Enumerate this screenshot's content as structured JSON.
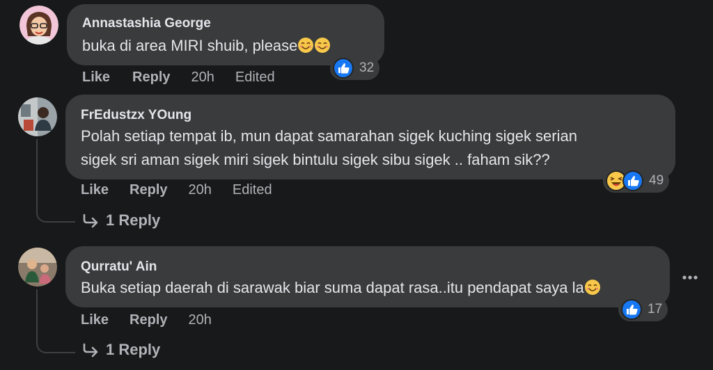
{
  "comments": [
    {
      "author": "Annastashia George",
      "text": "buka di area MIRI shuib, please",
      "reaction_count": "32",
      "actions": {
        "like": "Like",
        "reply": "Reply",
        "time": "20h",
        "edited": "Edited"
      }
    },
    {
      "author": "FrEdustzx YOung",
      "text_line1": "Polah setiap tempat ib, mun dapat samarahan sigek kuching sigek serian",
      "text_line2": "sigek sri aman sigek miri sigek bintulu sigek sibu sigek .. faham sik??",
      "reaction_count": "49",
      "actions": {
        "like": "Like",
        "reply": "Reply",
        "time": "20h",
        "edited": "Edited"
      },
      "replies_label": "1 Reply"
    },
    {
      "author": "Qurratu' Ain",
      "text": "Buka setiap daerah di sarawak biar suma dapat rasa..itu pendapat saya la",
      "reaction_count": "17",
      "actions": {
        "like": "Like",
        "reply": "Reply",
        "time": "20h"
      },
      "replies_label": "1 Reply"
    }
  ],
  "icons": {
    "like": "like-reaction-icon",
    "haha": "haha-reaction-icon",
    "smile": "smiling-face-emoji",
    "reply_arrow": "reply-arrow-icon",
    "more": "more-options-icon"
  },
  "colors": {
    "background": "#18191a",
    "bubble": "#3a3b3c",
    "primary_text": "#e4e6eb",
    "secondary_text": "#b0b3b8",
    "like_blue": "#1877f2"
  }
}
